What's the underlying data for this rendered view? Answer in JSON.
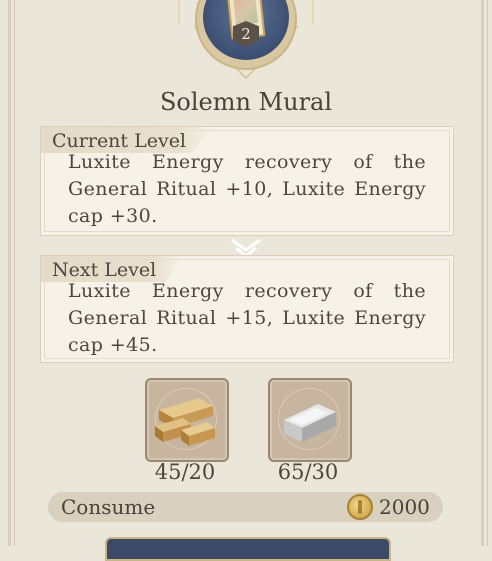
{
  "item": {
    "name": "Solemn Mural",
    "level_badge": "2",
    "icon": "mural-painting-icon"
  },
  "current_level": {
    "label": "Current Level",
    "description": "Luxite Energy recovery of the General Ritual +10, Luxite Energy cap +30."
  },
  "next_level": {
    "label": "Next Level",
    "description": "Luxite Energy recovery of the General Ritual +15, Luxite Energy cap +45."
  },
  "materials": [
    {
      "icon": "wood-planks-icon",
      "count": "45/20"
    },
    {
      "icon": "iron-ingot-icon",
      "count": "65/30"
    }
  ],
  "consume": {
    "label": "Consume",
    "currency_icon": "gold-coin-icon",
    "value": "2000"
  },
  "colors": {
    "background": "#ebe6da",
    "panel": "#f6f2e8",
    "emblem_blue": "#3c4f72",
    "coin_gold": "#c59a3c"
  }
}
